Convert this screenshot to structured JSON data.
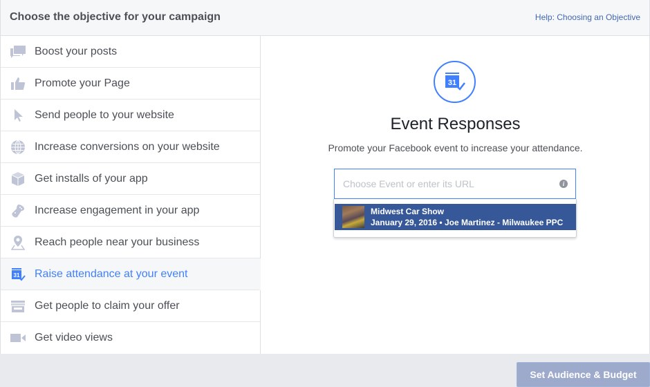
{
  "header": {
    "title": "Choose the objective for your campaign",
    "help_link": "Help: Choosing an Objective"
  },
  "objectives": [
    {
      "label": "Boost your posts",
      "icon": "speech-bubbles-icon",
      "selected": false
    },
    {
      "label": "Promote your Page",
      "icon": "thumbs-up-icon",
      "selected": false
    },
    {
      "label": "Send people to your website",
      "icon": "cursor-arrow-icon",
      "selected": false
    },
    {
      "label": "Increase conversions on your website",
      "icon": "globe-icon",
      "selected": false
    },
    {
      "label": "Get installs of your app",
      "icon": "cube-icon",
      "selected": false
    },
    {
      "label": "Increase engagement in your app",
      "icon": "game-controller-icon",
      "selected": false
    },
    {
      "label": "Reach people near your business",
      "icon": "map-pin-icon",
      "selected": false
    },
    {
      "label": "Raise attendance at your event",
      "icon": "calendar-check-icon",
      "selected": true
    },
    {
      "label": "Get people to claim your offer",
      "icon": "storefront-icon",
      "selected": false
    },
    {
      "label": "Get video views",
      "icon": "video-camera-icon",
      "selected": false
    }
  ],
  "main": {
    "icon": "calendar-check-icon",
    "calendar_day": "31",
    "title": "Event Responses",
    "subtitle": "Promote your Facebook event to increase your attendance.",
    "input": {
      "value": "",
      "placeholder": "Choose Event or enter its URL",
      "info_glyph": "i"
    },
    "dropdown": [
      {
        "title": "Midwest Car Show",
        "subtitle": "January 29, 2016 • Joe Martinez - Milwaukee PPC"
      }
    ]
  },
  "footer": {
    "continue_label": "Set Audience & Budget"
  },
  "colors": {
    "accent": "#4080ff",
    "icon_gray": "#bec3d6",
    "dropdown_highlight": "#365899",
    "button_disabled": "#9daacb"
  }
}
